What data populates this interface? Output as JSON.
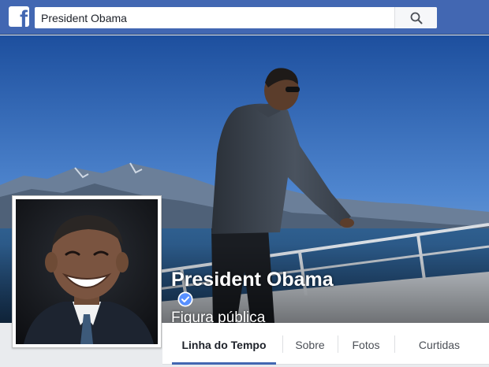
{
  "header": {
    "logo_letter": "f",
    "search": {
      "value": "President Obama"
    },
    "search_icon": "magnifier-icon"
  },
  "page": {
    "name": "President Obama",
    "verified_icon": "verified-check-icon",
    "category": "Figura pública"
  },
  "tabs": [
    {
      "label": "Linha do Tempo",
      "active": true
    },
    {
      "label": "Sobre",
      "active": false
    },
    {
      "label": "Fotos",
      "active": false
    },
    {
      "label": "Curtidas",
      "active": false
    }
  ],
  "colors": {
    "brand_blue": "#4267b2",
    "verified_blue": "#5890ff",
    "page_bg": "#e9ebee"
  }
}
